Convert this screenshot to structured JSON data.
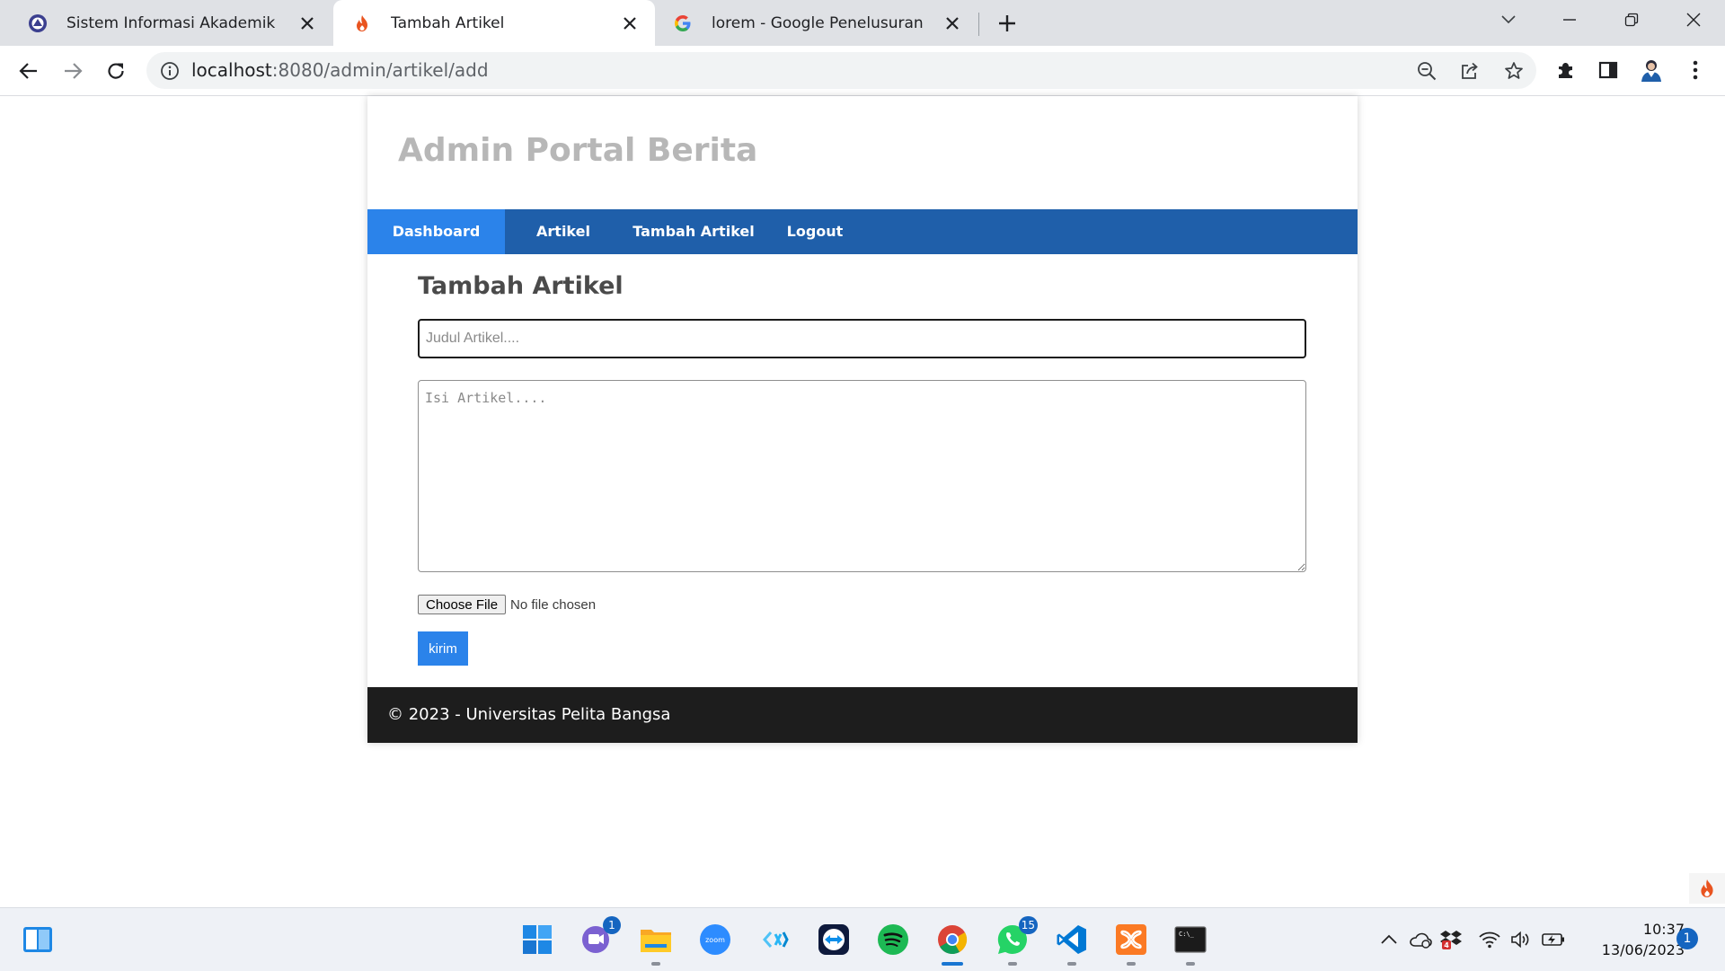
{
  "browser": {
    "tabs": [
      {
        "title": "Sistem Informasi Akademik",
        "icon": "university-logo-icon",
        "active": false
      },
      {
        "title": "Tambah Artikel",
        "icon": "flame-icon",
        "active": true
      },
      {
        "title": "lorem - Google Penelusuran",
        "icon": "google-icon",
        "active": false
      }
    ],
    "url_host": "localhost",
    "url_path": ":8080/admin/artikel/add"
  },
  "site": {
    "title": "Admin Portal Berita",
    "nav": [
      {
        "label": "Dashboard",
        "active": true
      },
      {
        "label": "Artikel",
        "active": false
      },
      {
        "label": "Tambah Artikel",
        "active": false
      },
      {
        "label": "Logout",
        "active": false
      }
    ],
    "footer": "© 2023 - Universitas Pelita Bangsa"
  },
  "form": {
    "heading": "Tambah Artikel",
    "judul_placeholder": "Judul Artikel....",
    "judul_value": "",
    "isi_placeholder": "Isi Artikel....",
    "isi_value": "",
    "file_button": "Choose File",
    "file_status": "No file chosen",
    "submit_label": "kirim"
  },
  "taskbar": {
    "apps": [
      {
        "name": "windows-start-icon"
      },
      {
        "name": "teams-icon",
        "badge": "1"
      },
      {
        "name": "file-explorer-icon"
      },
      {
        "name": "zoom-icon",
        "label": "zoom"
      },
      {
        "name": "code-blocks-icon"
      },
      {
        "name": "teamviewer-icon"
      },
      {
        "name": "spotify-icon"
      },
      {
        "name": "chrome-icon"
      },
      {
        "name": "whatsapp-icon",
        "badge": "15"
      },
      {
        "name": "vscode-icon"
      },
      {
        "name": "xampp-icon"
      },
      {
        "name": "terminal-icon",
        "label": "C:\\_"
      }
    ],
    "time": "10:37",
    "date": "13/06/2023",
    "notifications": "1"
  },
  "colors": {
    "nav_bg": "#1f5faa",
    "nav_active": "#2b83ea",
    "footer_bg": "#1d1d1d",
    "title_color": "#b7b7b7",
    "button_bg": "#2b83ea"
  }
}
